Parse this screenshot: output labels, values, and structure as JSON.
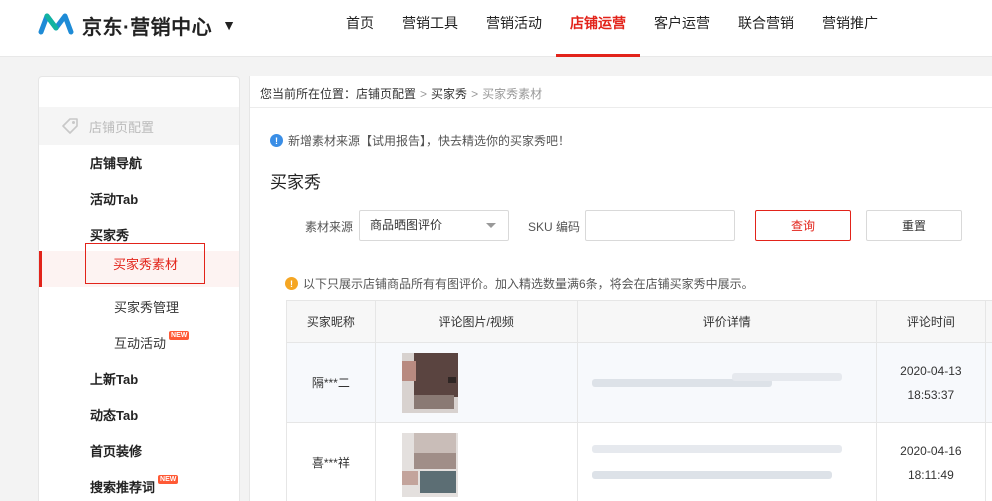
{
  "header": {
    "brand": "京东·营销中心",
    "brand_caret": "▼",
    "nav": [
      "首页",
      "营销工具",
      "营销活动",
      "店铺运营",
      "客户运营",
      "联合营销",
      "营销推广"
    ],
    "active_nav": "店铺运营",
    "accent_color": "#e2231a"
  },
  "sidebar": {
    "section": "店铺页配置",
    "section_icon": "tag-icon",
    "items": {
      "nav": "店铺导航",
      "activity_tab": "活动Tab",
      "buyer_show": "买家秀",
      "buyer_show_material": "买家秀素材",
      "buyer_show_manage": "买家秀管理",
      "interactive": "互动活动",
      "new_tab": "上新Tab",
      "dynamic_tab": "动态Tab",
      "home_decor": "首页装修",
      "search_words": "搜索推荐词"
    },
    "new_badge": "NEW"
  },
  "breadcrumb": {
    "prefix": "您当前所在位置：",
    "level1": "店铺页配置",
    "level2": "买家秀",
    "level3": "买家秀素材",
    "sep": ">"
  },
  "notice_top": "新增素材来源【试用报告】，快去精选你的买家秀吧！",
  "page_title": "买家秀",
  "filters": {
    "source_label": "素材来源",
    "source_value": "商品晒图评价",
    "sku_label": "SKU 编码",
    "sku_value": "",
    "query_label": "查询",
    "reset_label": "重置"
  },
  "notice_table": "以下只展示店铺商品所有有图评价。加入精选数量满6条，将会在店铺买家秀中展示。",
  "table": {
    "columns": [
      "买家昵称",
      "评论图片/视频",
      "评价详情",
      "评论时间"
    ],
    "rows": [
      {
        "nickname": "隔***二",
        "date": "2020-04-13",
        "time": "18:53:37"
      },
      {
        "nickname": "喜***祥",
        "date": "2020-04-16",
        "time": "18:11:49"
      }
    ]
  }
}
